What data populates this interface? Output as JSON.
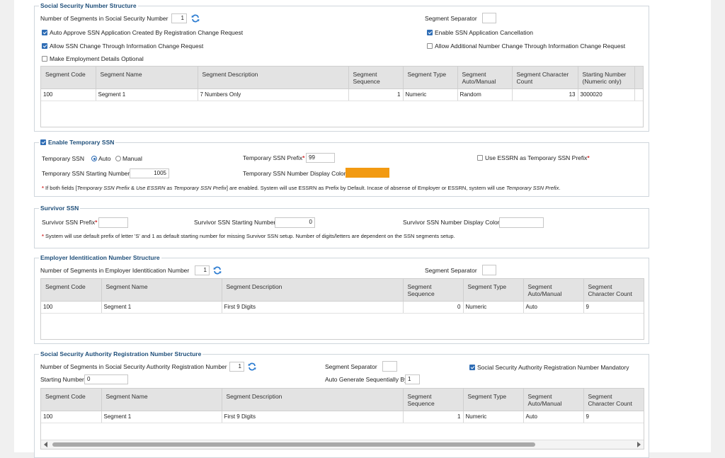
{
  "ssn": {
    "legend": "Social Security Number Structure",
    "segments_label": "Number of Segments in Social Security Number",
    "segments_value": "1",
    "separator_label": "Segment Separator",
    "separator_value": "",
    "auto_approve": {
      "label": "Auto Approve SSN Application Created By Registration Change Request",
      "checked": true
    },
    "enable_cancel": {
      "label": "Enable SSN Application Cancellation",
      "checked": true
    },
    "allow_change": {
      "label": "Allow SSN Change Through Information Change Request",
      "checked": true
    },
    "allow_additional": {
      "label": "Allow Additional Number Change Through Information Change Request",
      "checked": false
    },
    "employment_optional": {
      "label": "Make Employment Details Optional",
      "checked": false
    },
    "table": {
      "headers": [
        "Segment Code",
        "Segment Name",
        "Segment Description",
        "Segment Sequence",
        "Segment Type",
        "Segment Auto/Manual",
        "Segment Character Count",
        "Starting Number (Numeric only)"
      ],
      "rows": [
        [
          "100",
          "Segment 1",
          "7 Numbers Only",
          "1",
          "Numeric",
          "Random",
          "13",
          "3000020"
        ]
      ]
    }
  },
  "temp_ssn": {
    "legend": "Enable Temporary SSN",
    "enabled": true,
    "temp_label": "Temporary SSN",
    "auto_label": "Auto",
    "manual_label": "Manual",
    "mode": "Auto",
    "prefix_label": "Temporary SSN Prefix",
    "prefix_value": "99",
    "use_essrn_label": "Use ESSRN as Temporary SSN Prefix",
    "use_essrn_checked": false,
    "start_label": "Temporary SSN Starting Number",
    "start_value": "1005",
    "color_label": "Temporary SSN Number Display Color",
    "color_value": "#f29a12",
    "note_1": "If both fields [",
    "note_em1": "Temporary SSN Prefix",
    "note_2": " & ",
    "note_em2": "Use ESSRN as Temporary SSN Prefix",
    "note_3": "] are enabled. System will use ESSRN as Prefix by Default. Incase of absense of Employer or ESSRN, system will use ",
    "note_em3": "Temporary SSN Prefix",
    "note_4": "."
  },
  "survivor": {
    "legend": "Survivor SSN",
    "prefix_label": "Survivor SSN Prefix",
    "prefix_value": "",
    "start_label": "Survivor SSN Starting Number",
    "start_value": "0",
    "color_label": "Survivor SSN Number Display Color",
    "color_value": "",
    "note": "System will use default prefix of letter 'S' and 1 as default starting number for missing Survivor SSN setup. Number of digits/letters are dependent on the SSN segments setup."
  },
  "ein": {
    "legend": "Employer Identitication Number Structure",
    "segments_label": "Number of Segments in Employer Identitication Number",
    "segments_value": "1",
    "separator_label": "Segment Separator",
    "separator_value": "",
    "table": {
      "headers": [
        "Segment Code",
        "Segment Name",
        "Segment Description",
        "Segment Sequence",
        "Segment Type",
        "Segment Auto/Manual",
        "Segment Character Count"
      ],
      "rows": [
        [
          "100",
          "Segment 1",
          "First 9 Digits",
          "0",
          "Numeric",
          "Auto",
          "9"
        ]
      ]
    }
  },
  "ssa": {
    "legend": "Social Security Authority Registration Number Structure",
    "segments_label": "Number of Segments in Social Security Authority Registration Number",
    "segments_value": "1",
    "separator_label": "Segment Separator",
    "separator_value": "",
    "mandatory_label": "Social Security Authority Registration Number Mandatory",
    "mandatory_checked": true,
    "starting_label": "Starting Number",
    "starting_value": "0",
    "auto_gen_label": "Auto Generate Sequentially By",
    "auto_gen_value": "1",
    "table": {
      "headers": [
        "Segment Code",
        "Segment Name",
        "Segment Description",
        "Segment Sequence",
        "Segment Type",
        "Segment Auto/Manual",
        "Segment Character Count"
      ],
      "rows": [
        [
          "100",
          "Segment 1",
          "First 9 Digits",
          "1",
          "Numeric",
          "Auto",
          "9"
        ]
      ]
    }
  }
}
